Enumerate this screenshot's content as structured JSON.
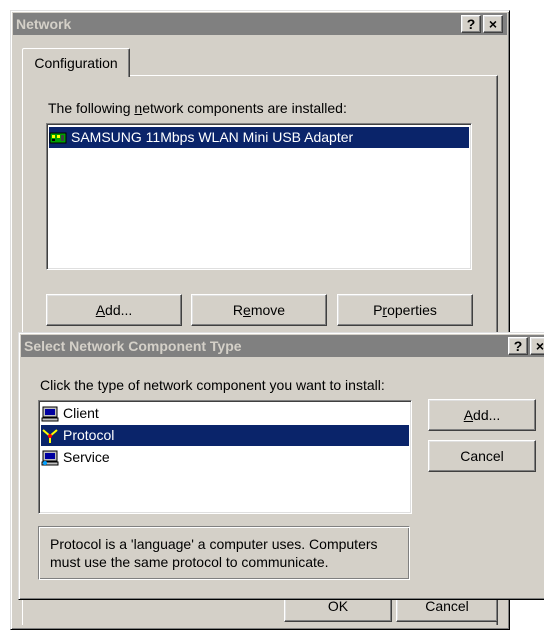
{
  "network_dialog": {
    "title": "Network",
    "help_btn": "?",
    "close_btn": "×",
    "tab_label": "Configuration",
    "components_label_pre": "The following ",
    "components_label_u": "n",
    "components_label_post": "etwork components are installed:",
    "components": [
      {
        "label": "SAMSUNG 11Mbps WLAN Mini USB Adapter",
        "icon": "network-adapter-icon",
        "selected": true
      }
    ],
    "add_btn_u": "A",
    "add_btn_rest": "dd...",
    "remove_btn_pre": "R",
    "remove_btn_u": "e",
    "remove_btn_post": "move",
    "properties_btn_pre": "P",
    "properties_btn_u": "r",
    "properties_btn_post": "operties",
    "ok_btn": "OK",
    "cancel_btn": "Cancel"
  },
  "select_dialog": {
    "title": "Select Network Component Type",
    "help_btn": "?",
    "close_btn": "×",
    "prompt": "Click the type of network component you want to install:",
    "items": [
      {
        "label": "Client",
        "icon": "client-computer-icon",
        "selected": false
      },
      {
        "label": "Protocol",
        "icon": "protocol-icon",
        "selected": true
      },
      {
        "label": "Service",
        "icon": "service-computer-icon",
        "selected": false
      }
    ],
    "add_btn_u": "A",
    "add_btn_rest": "dd...",
    "cancel_btn": "Cancel",
    "description": "Protocol is a 'language' a computer uses. Computers must use the same protocol to communicate."
  },
  "colors": {
    "face": "#d4d0c8",
    "selection": "#0a246a",
    "inactive_title": "#808080"
  }
}
